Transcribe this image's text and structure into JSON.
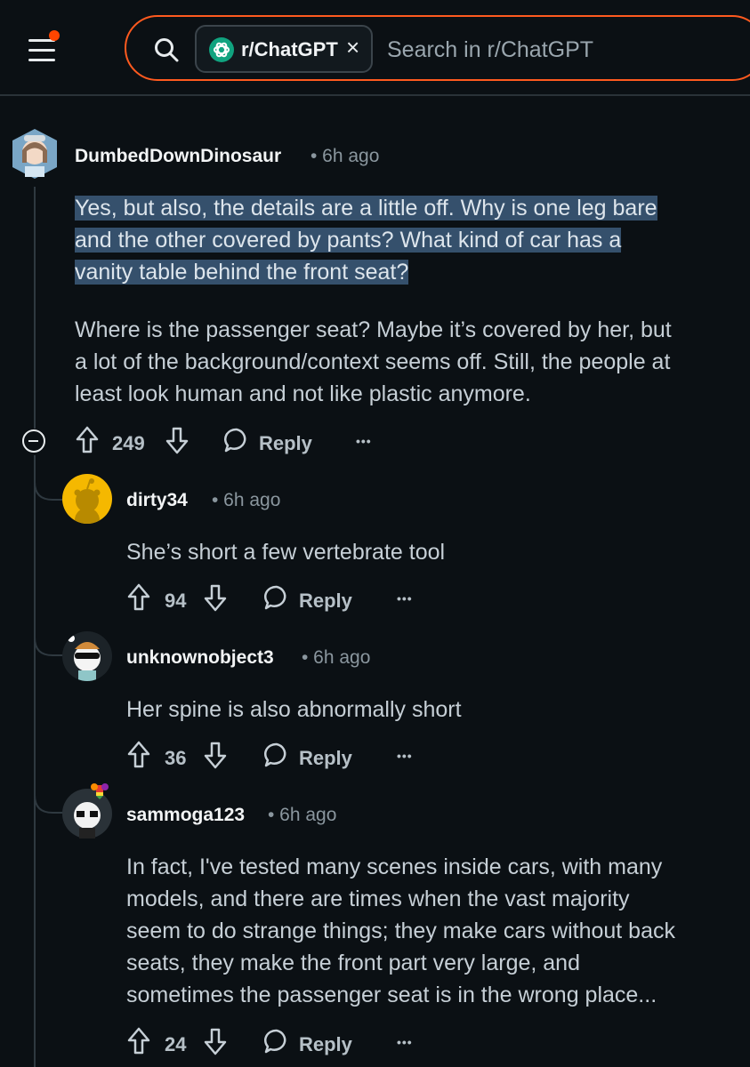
{
  "header": {
    "subreddit_chip": "r/ChatGPT",
    "chip_close": "×",
    "search_placeholder": "Search in r/ChatGPT",
    "icons": [
      "menu-icon",
      "notification-dot",
      "search-icon",
      "chatgpt-logo-icon",
      "close-icon"
    ],
    "accent_color": "#ff5a1f"
  },
  "comments": [
    {
      "username": "DumbedDownDinosaur",
      "time": "• 6h ago",
      "paragraph_1_lines": [
        "Yes, but also, the details are a little off. Why is one leg bare",
        "and the other covered by pants? What kind of car has a",
        "vanity table behind the front seat?"
      ],
      "paragraph_2_lines": [
        "Where is the passenger seat? Maybe it’s covered by her, but",
        "a lot of the background/context seems off. Still, the people at",
        "least look human and not like plastic anymore."
      ],
      "votes": "249",
      "reply": "Reply",
      "more": "•••",
      "highlight_color": "#35506c"
    },
    {
      "username": "dirty34",
      "time": "• 6h ago",
      "lines": [
        "She’s short a few vertebrate tool"
      ],
      "votes": "94",
      "reply": "Reply",
      "more": "•••"
    },
    {
      "username": "unknownobject3",
      "time": "• 6h ago",
      "lines": [
        "Her spine is also abnormally short"
      ],
      "votes": "36",
      "reply": "Reply",
      "more": "•••"
    },
    {
      "username": "sammoga123",
      "time": "• 6h ago",
      "lines": [
        "In fact, I've tested many scenes inside cars, with many",
        "models, and there are times when the vast majority",
        "seem to do strange things; they make cars without back",
        "seats, they make the front part very large, and",
        "sometimes the passenger seat is in the wrong place..."
      ],
      "votes": "24",
      "reply": "Reply",
      "more": "•••"
    }
  ]
}
